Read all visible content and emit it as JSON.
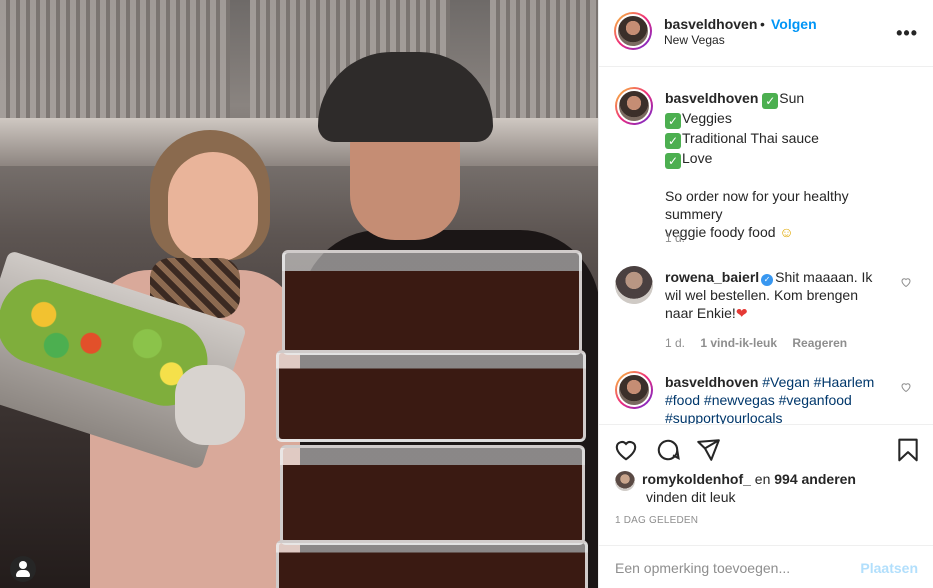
{
  "post": {
    "username": "basveldhoven",
    "separator": "•",
    "follow_label": "Volgen",
    "location": "New Vegas",
    "more_label": "•••"
  },
  "caption": {
    "username": "basveldhoven",
    "lines": [
      "Sun",
      "Veggies",
      "Traditional Thai sauce",
      "Love"
    ],
    "check_icon": "check-mark-emoji",
    "para_line1": "So order now for your healthy summery",
    "para_line2": "veggie foody food",
    "para_emoji": "☺",
    "time": "1 d."
  },
  "comments": [
    {
      "username": "rowena_baierl",
      "verified_mark": "✓",
      "text_line1": "Shit maaaan. Ik",
      "text_line2": "wil wel bestellen. Kom brengen",
      "text_line3": "naar Enkie!",
      "emoji": "❤",
      "time": "1 d.",
      "likes": "1 vind-ik-leuk",
      "reply_label": "Reageren"
    },
    {
      "username": "basveldhoven",
      "line1": "#Vegan #Haarlem",
      "line2": "#food #newvegas #veganfood",
      "line3": "#supportyourlocals"
    }
  ],
  "likes": {
    "user": "romykoldenhof_",
    "connector": "en",
    "count": "994 anderen",
    "suffix": "vinden dit leuk"
  },
  "date": "1 DAG GELEDEN",
  "add_comment": {
    "placeholder": "Een opmerking toevoegen...",
    "post_label": "Plaatsen"
  },
  "colors": {
    "accent": "#0095f6",
    "link": "#00376b",
    "muted": "#8e8e8e",
    "post_disabled": "#b2dffc",
    "check": "#4caf50",
    "heart": "#e53935"
  }
}
